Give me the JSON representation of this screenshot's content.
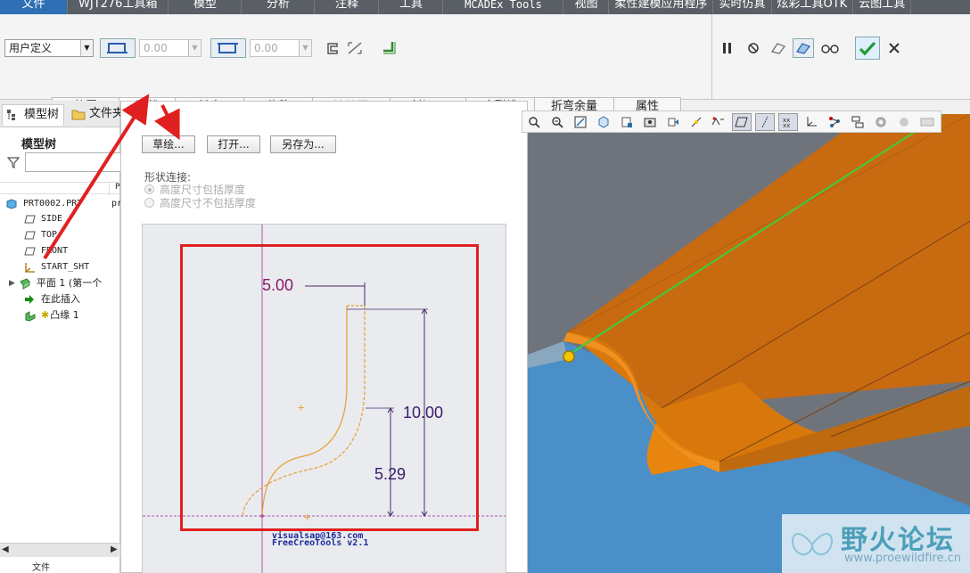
{
  "menubar": [
    "文件",
    "WJT276工具箱",
    "模型",
    "分析",
    "注释",
    "工具",
    "MCADEx Tools",
    "视图",
    "柔性建模应用程序",
    "实时仿真",
    "炫彩工具OTK",
    "云图工具"
  ],
  "ribbon": {
    "profile_select": "用户定义",
    "thickness_1": "0.00",
    "thickness_2": "0.00",
    "tabs": [
      "放置",
      "形状",
      "长度",
      "偏移",
      "边处理",
      "斜切口",
      "止裂槽",
      "折弯余量",
      "属性"
    ],
    "active_tab": "形状",
    "disabled_tab": "边处理"
  },
  "left_panel": {
    "tab_model_tree": "模型树",
    "tab_folder": "文件夹",
    "title": "模型树",
    "column_header": "P",
    "items": [
      {
        "label": "PRT0002.PRT",
        "extra": "pr"
      },
      {
        "label": "SIDE"
      },
      {
        "label": "TOP"
      },
      {
        "label": "FRONT"
      },
      {
        "label": "START_SHT"
      },
      {
        "label": "平面 1 (第一个"
      },
      {
        "label": "在此插入"
      },
      {
        "label": "凸缘 1"
      }
    ],
    "bottom_label": "文件"
  },
  "shape_panel": {
    "btn_sketch": "草绘...",
    "btn_open": "打开...",
    "btn_saveas": "另存为...",
    "connect_label": "形状连接:",
    "radio_include": "高度尺寸包括厚度",
    "radio_exclude": "高度尺寸不包括厚度",
    "dim_top": "5.00",
    "dim_height": "10.00",
    "dim_mid": "5.29",
    "sketch_note_1": "visualsap@163.com",
    "sketch_note_2": "FreeCreoTools v2.1"
  },
  "watermark": {
    "cn": "野火论坛",
    "en": "www.proewildfire.cn"
  },
  "colors": {
    "accent_orange": "#e8850f",
    "red_arrow": "#e02020",
    "dim_purple": "#6a1b7a",
    "viewport_blue": "#4a8fc8",
    "viewport_gray": "#6f747c"
  }
}
